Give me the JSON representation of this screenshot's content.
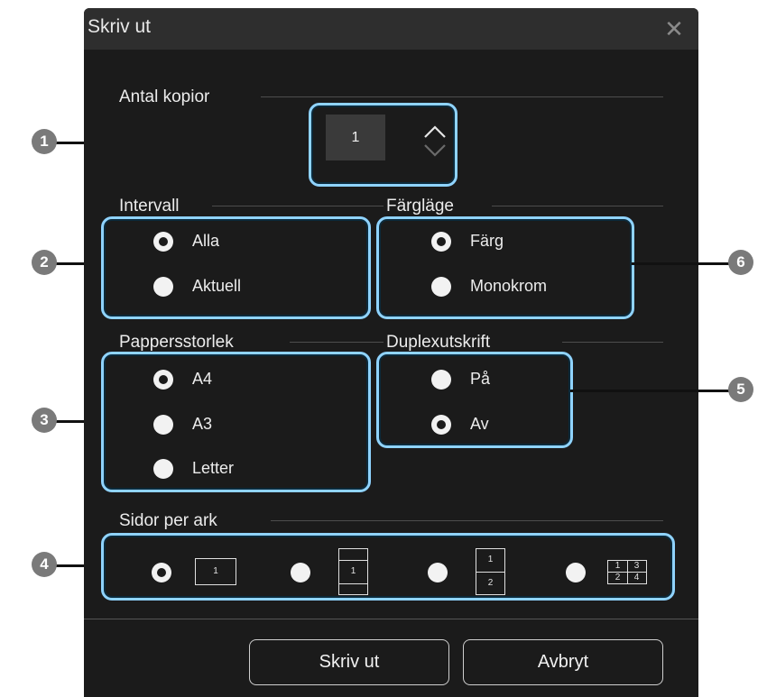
{
  "dialog": {
    "title": "Skriv ut",
    "close_symbol": "✕"
  },
  "copies": {
    "label": "Antal kopior",
    "value": "1"
  },
  "range": {
    "label": "Intervall",
    "options": [
      "Alla",
      "Aktuell"
    ],
    "selected": "Alla"
  },
  "color_mode": {
    "label": "Färgläge",
    "options": [
      "Färg",
      "Monokrom"
    ],
    "selected": "Färg"
  },
  "paper_size": {
    "label": "Pappersstorlek",
    "options": [
      "A4",
      "A3",
      "Letter"
    ],
    "selected": "A4"
  },
  "duplex": {
    "label": "Duplexutskrift",
    "options": [
      "På",
      "Av"
    ],
    "selected": "Av"
  },
  "pages_per_sheet": {
    "label": "Sidor per ark",
    "options": [
      {
        "layout": "1",
        "cells": [
          "1"
        ]
      },
      {
        "layout": "1-center",
        "cells": [
          "1"
        ]
      },
      {
        "layout": "2",
        "cells": [
          "1",
          "2"
        ]
      },
      {
        "layout": "4",
        "cells": [
          "1",
          "3",
          "2",
          "4"
        ]
      }
    ],
    "selected": "1"
  },
  "buttons": {
    "print": "Skriv ut",
    "cancel": "Avbryt"
  },
  "callouts": [
    "1",
    "2",
    "3",
    "4",
    "5",
    "6"
  ],
  "colors": {
    "dialog_bg": "#1b1b1b",
    "titlebar_bg": "#2e2e2e",
    "highlight": "#8fd3ff",
    "callout": "#7a7a7a"
  }
}
